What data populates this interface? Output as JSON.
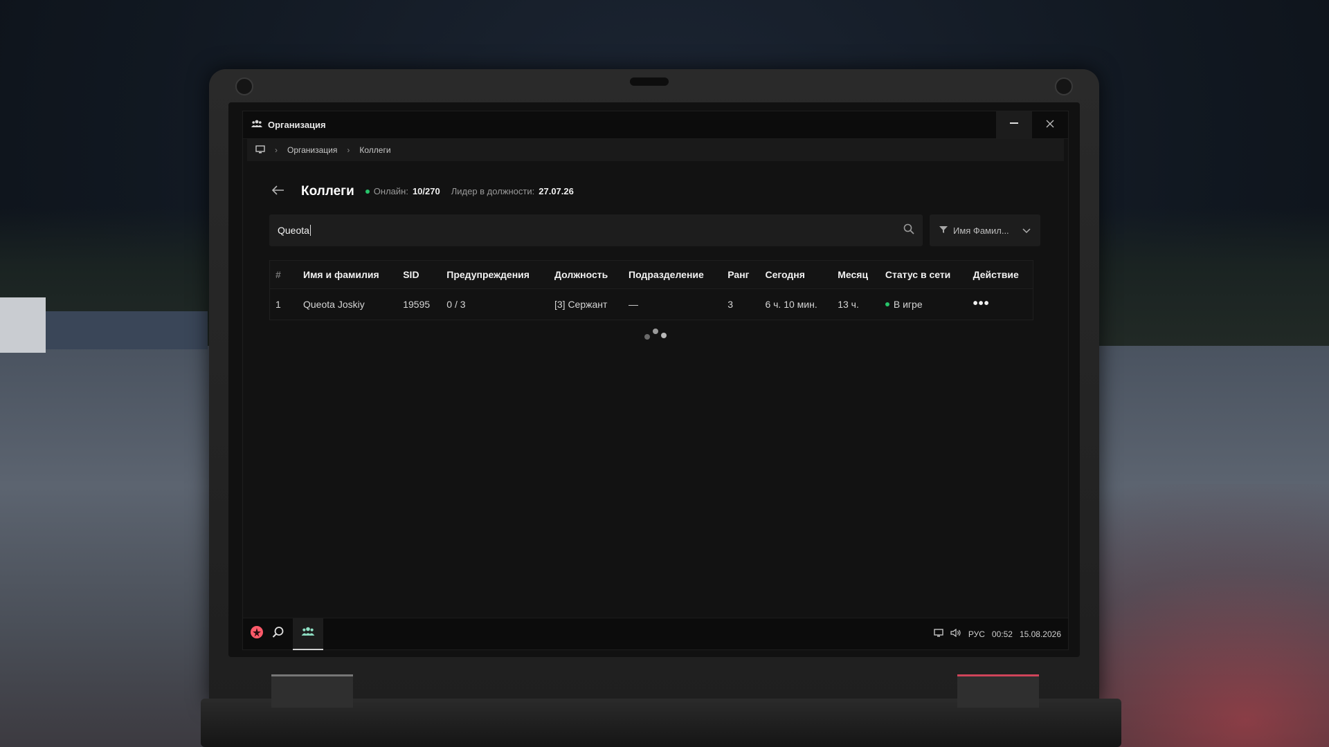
{
  "window": {
    "title": "Организация"
  },
  "breadcrumb": {
    "items": [
      "Организация",
      "Коллеги"
    ]
  },
  "header": {
    "title": "Коллеги",
    "online_label": "Онлайн:",
    "online_value": "10/270",
    "leader_label": "Лидер в должности:",
    "leader_value": "27.07.26"
  },
  "search": {
    "value": "Queota",
    "filter_label": "Имя Фамил..."
  },
  "table": {
    "columns": [
      "#",
      "Имя и фамилия",
      "SID",
      "Предупреждения",
      "Должность",
      "Подразделение",
      "Ранг",
      "Сегодня",
      "Месяц",
      "Статус в сети",
      "Действие"
    ],
    "rows": [
      {
        "num": "1",
        "name": "Queota Joskiy",
        "sid": "19595",
        "warnings": "0 / 3",
        "position": "[3] Сержант",
        "division": "—",
        "rank": "3",
        "today": "6 ч. 10 мин.",
        "month": "13 ч.",
        "status": "В игре",
        "action": "•••"
      }
    ]
  },
  "taskbar": {
    "lang": "РУС",
    "time": "00:52",
    "date": "15.08.2026"
  },
  "colors": {
    "online_dot": "#27c46a",
    "accent_logo": "#ff5a6a"
  },
  "icons": [
    "people-icon",
    "minimize-icon",
    "close-icon",
    "monitor-icon",
    "chevron-right-icon",
    "back-arrow-icon",
    "search-icon",
    "filter-icon",
    "chevron-down-icon",
    "more-dots-icon",
    "loading-spinner",
    "logo-icon",
    "volume-icon"
  ]
}
